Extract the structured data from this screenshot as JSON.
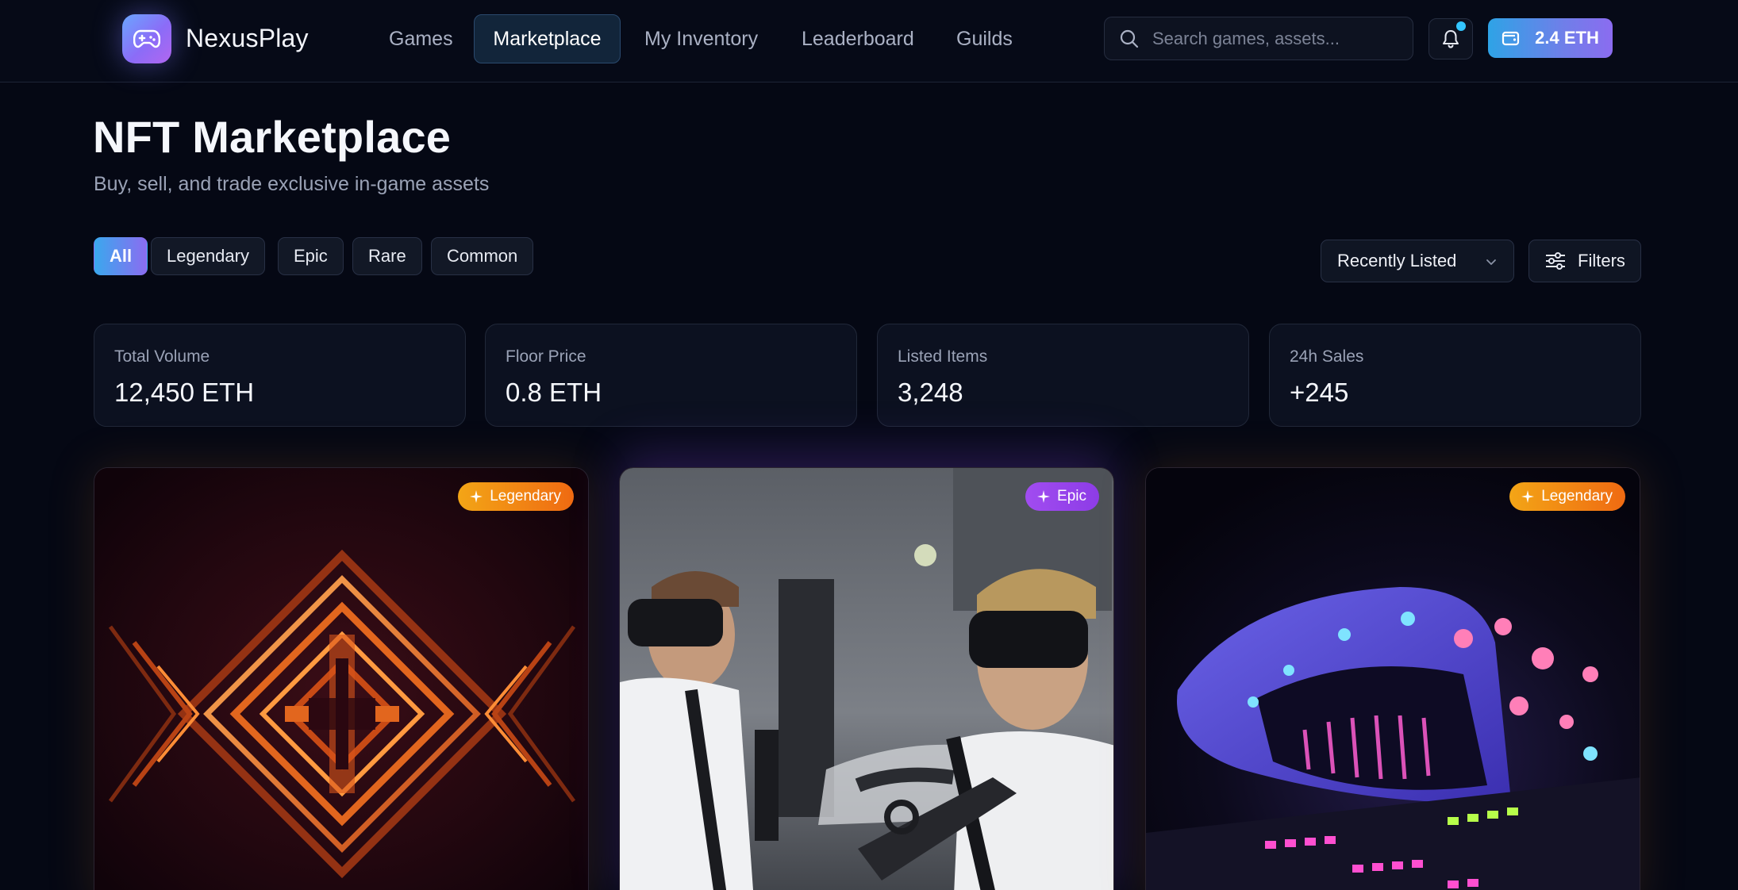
{
  "app": {
    "brand_name": "NexusPlay",
    "logo_icon": "gamepad-icon",
    "accent_gradient": [
      "#2ea3e6",
      "#8b6cf0"
    ]
  },
  "nav": {
    "items": [
      {
        "label": "Games",
        "active": false
      },
      {
        "label": "Marketplace",
        "active": true
      },
      {
        "label": "My Inventory",
        "active": false
      },
      {
        "label": "Leaderboard",
        "active": false
      },
      {
        "label": "Guilds",
        "active": false
      }
    ]
  },
  "search": {
    "placeholder": "Search games, assets...",
    "value": ""
  },
  "notifications": {
    "icon": "bell-icon",
    "has_unread": true
  },
  "wallet": {
    "icon": "wallet-icon",
    "balance": "2.4 ETH"
  },
  "header": {
    "title": "NFT Marketplace",
    "subtitle": "Buy, sell, and trade exclusive in-game assets"
  },
  "rarity_filters": [
    {
      "label": "All",
      "active": true
    },
    {
      "label": "Legendary",
      "active": false
    },
    {
      "label": "Epic",
      "active": false
    },
    {
      "label": "Rare",
      "active": false
    },
    {
      "label": "Common",
      "active": false
    }
  ],
  "sort": {
    "selected": "Recently Listed",
    "icon": "chevron-down-icon"
  },
  "filters_button": {
    "label": "Filters",
    "icon": "sliders-icon"
  },
  "stats": [
    {
      "label": "Total Volume",
      "value": "12,450 ETH"
    },
    {
      "label": "Floor Price",
      "value": "0.8 ETH"
    },
    {
      "label": "Listed Items",
      "value": "3,248"
    },
    {
      "label": "24h Sales",
      "value": "+245"
    }
  ],
  "cards": [
    {
      "rarity": "Legendary",
      "rarity_color": "#f0a016",
      "art": "orange-diamond-art"
    },
    {
      "rarity": "Epic",
      "rarity_color": "#9b45ee",
      "art": "vr-players-photo"
    },
    {
      "rarity": "Legendary",
      "rarity_color": "#f0a016",
      "art": "neon-vr-headset-photo"
    }
  ]
}
